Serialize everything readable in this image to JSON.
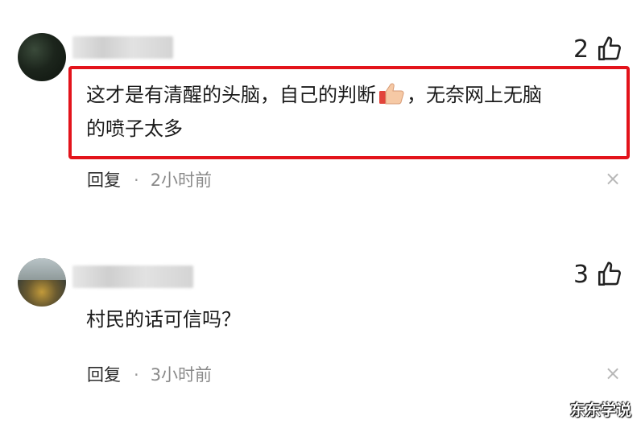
{
  "comments": [
    {
      "likes": "2",
      "text_part1": "这才是有清醒的头脑，自己的判断",
      "text_part2": "，无奈网上无脑",
      "text_line2": "的喷子太多",
      "reply_label": "回复",
      "separator": "·",
      "time": "2小时前",
      "close": "×"
    },
    {
      "likes": "3",
      "text_line1": "村民的话可信吗？",
      "reply_label": "回复",
      "separator": "·",
      "time": "3小时前",
      "close": "×"
    }
  ],
  "watermark": "东东学说",
  "colors": {
    "highlight": "#e3131b",
    "meta_gray": "#8a8a8a"
  },
  "icons": [
    "thumbs-up-icon",
    "close-icon",
    "thumbs-up-emoji"
  ]
}
